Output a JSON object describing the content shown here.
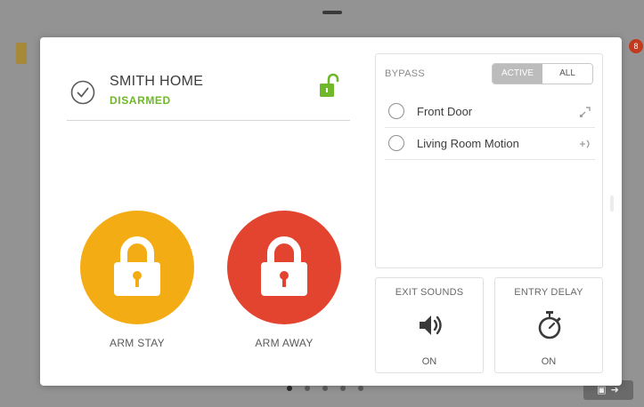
{
  "system": {
    "name": "SMITH HOME",
    "state": "DISARMED",
    "state_color": "#6fb829"
  },
  "arm_buttons": [
    {
      "label": "ARM STAY",
      "color": "#f4ac14"
    },
    {
      "label": "ARM AWAY",
      "color": "#e24430"
    }
  ],
  "bypass": {
    "title": "BYPASS",
    "filter_options": [
      "ACTIVE",
      "ALL"
    ],
    "selected_filter": "ACTIVE",
    "zones": [
      {
        "name": "Front Door",
        "icon": "door-sensor-icon"
      },
      {
        "name": "Living Room Motion",
        "icon": "motion-sensor-icon"
      }
    ]
  },
  "exit_sounds": {
    "title": "EXIT SOUNDS",
    "value": "ON",
    "icon": "speaker-icon"
  },
  "entry_delay": {
    "title": "ENTRY DELAY",
    "value": "ON",
    "icon": "stopwatch-icon"
  },
  "background": {
    "notification_badge": "8"
  }
}
